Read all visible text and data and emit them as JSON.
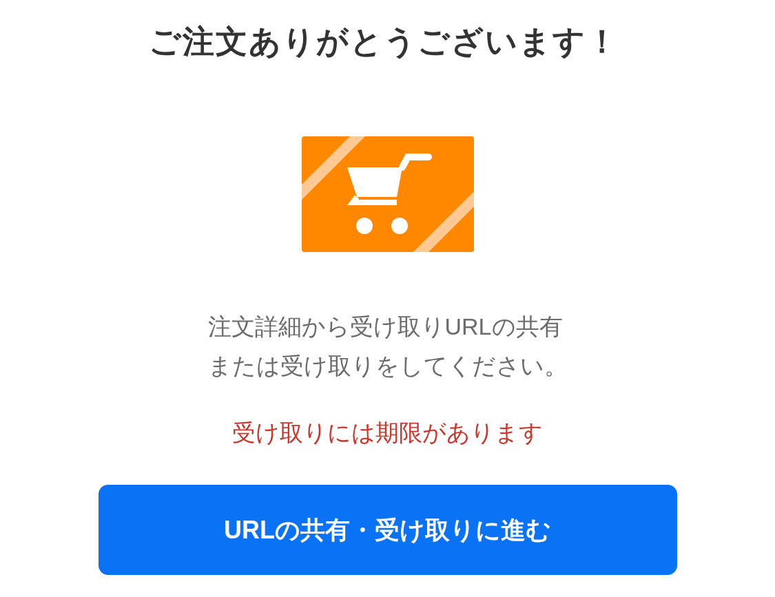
{
  "title": "ご注文ありがとうございます！",
  "message_lines": [
    "注文詳細から受け取りURLの共有",
    "または受け取りをしてください。"
  ],
  "notice": "受け取りには期限があります",
  "button": {
    "label": "URLの共有・受け取りに進む"
  }
}
